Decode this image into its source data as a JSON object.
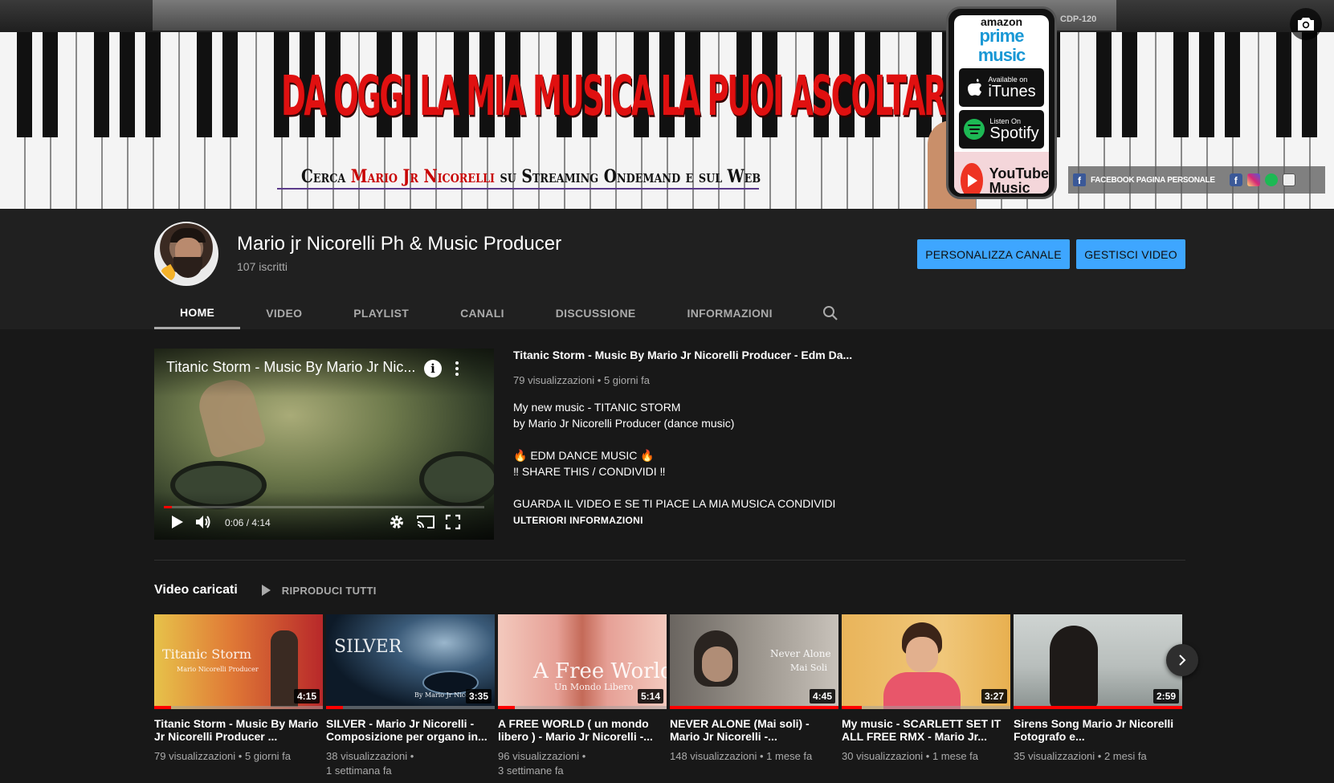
{
  "banner": {
    "model_label": "CDP-120",
    "headline": "DA OGGI LA MIA MUSICA LA PUOI ASCOLTARE SU:",
    "sub_prefix": "Cerca",
    "sub_name": "Mario Jr Nicorelli",
    "sub_suffix": "su Streaming Ondemand e sul Web",
    "phone": {
      "amazon": "amazon",
      "prime": "prime music",
      "itunes_small": "Available on",
      "itunes_big": "iTunes",
      "spotify_small": "Listen On",
      "spotify_big": "Spotify",
      "yt_line1": "YouTube",
      "yt_line2": "Music"
    },
    "links_label": "FACEBOOK PAGINA PERSONALE",
    "social_colors": [
      "#3b5998",
      "#d62976",
      "#1db954",
      "#ffffff"
    ]
  },
  "channel": {
    "name": "Mario jr Nicorelli Ph & Music Producer",
    "subscribers": "107 iscritti",
    "customize_label": "PERSONALIZZA CANALE",
    "manage_label": "GESTISCI VIDEO"
  },
  "tabs": [
    "HOME",
    "VIDEO",
    "PLAYLIST",
    "CANALI",
    "DISCUSSIONE",
    "INFORMAZIONI"
  ],
  "featured": {
    "player_title": "Titanic Storm - Music By Mario Jr Nic...",
    "time": "0:06 / 4:14",
    "progress": 0.024,
    "title": "Titanic Storm - Music By Mario Jr Nicorelli Producer - Edm Da...",
    "meta": "79 visualizzazioni • 5 giorni fa",
    "desc": [
      "My new music - TITANIC STORM",
      "by Mario Jr Nicorelli Producer (dance music)",
      "",
      "🔥 EDM DANCE MUSIC 🔥",
      "‼ SHARE THIS / CONDIVIDI ‼",
      "",
      "GUARDA IL VIDEO E SE TI PIACE LA MIA MUSICA CONDIVIDI"
    ],
    "more": "ULTERIORI INFORMAZIONI"
  },
  "shelf": {
    "title": "Video caricati",
    "play_all": "RIPRODUCI TUTTI",
    "videos": [
      {
        "title": "Titanic Storm - Music By Mario Jr Nicorelli Producer ...",
        "meta1": "79 visualizzazioni • 5 giorni fa",
        "meta2": "",
        "duration": "4:15",
        "progress": 0.1,
        "overlay": "Titanic Storm",
        "overlay2": "Mario Nicorelli Producer"
      },
      {
        "title": "SILVER - Mario Jr Nicorelli - Composizione per organo in...",
        "meta1": "38 visualizzazioni •",
        "meta2": "1 settimana fa",
        "duration": "3:35",
        "progress": 0.1,
        "overlay": "SILVER",
        "overlay2": "By Mario Jr Nicorelli"
      },
      {
        "title": "A FREE WORLD ( un mondo libero ) - Mario Jr Nicorelli -...",
        "meta1": "96 visualizzazioni •",
        "meta2": "3 settimane fa",
        "duration": "5:14",
        "progress": 0.1,
        "overlay": "A Free World",
        "overlay2": "Un Mondo Libero"
      },
      {
        "title": "NEVER ALONE (Mai soli) - Mario Jr Nicorelli -...",
        "meta1": "148 visualizzazioni • 1 mese fa",
        "meta2": "",
        "duration": "4:45",
        "progress": 1.0,
        "overlay": "Never Alone",
        "overlay2": "Mai Soli"
      },
      {
        "title": "My music - SCARLETT SET IT ALL FREE RMX - Mario Jr...",
        "meta1": "30 visualizzazioni • 1 mese fa",
        "meta2": "",
        "duration": "3:27",
        "progress": 0.12,
        "overlay": "",
        "overlay2": ""
      },
      {
        "title": "Sirens Song Mario Jr Nicorelli Fotografo e...",
        "meta1": "35 visualizzazioni • 2 mesi fa",
        "meta2": "",
        "duration": "2:59",
        "progress": 1.0,
        "overlay": "",
        "overlay2": ""
      }
    ]
  }
}
